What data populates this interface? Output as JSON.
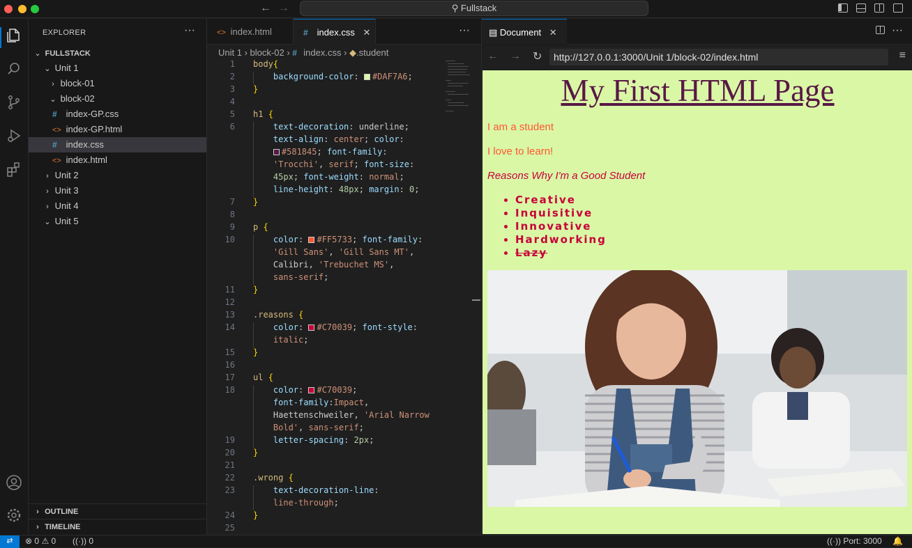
{
  "window": {
    "title": "Fullstack"
  },
  "activity": {
    "icons": [
      "files-icon",
      "search-icon",
      "source-control-icon",
      "run-debug-icon",
      "extensions-icon",
      "account-icon",
      "settings-icon"
    ]
  },
  "explorer": {
    "title": "EXPLORER",
    "root": "FULLSTACK",
    "items": [
      {
        "label": "Unit 1"
      },
      {
        "label": "block-01"
      },
      {
        "label": "block-02"
      },
      {
        "label": "index-GP.css"
      },
      {
        "label": "index-GP.html"
      },
      {
        "label": "index.css"
      },
      {
        "label": "index.html"
      },
      {
        "label": "Unit 2"
      },
      {
        "label": "Unit 3"
      },
      {
        "label": "Unit 4"
      },
      {
        "label": "Unit 5"
      }
    ],
    "outline": "OUTLINE",
    "timeline": "TIMELINE"
  },
  "editor": {
    "tabs": [
      {
        "label": "index.html"
      },
      {
        "label": "index.css"
      }
    ],
    "breadcrumb": {
      "unit": "Unit 1",
      "block": "block-02",
      "file": "index.css",
      "symbol": ".student"
    },
    "line_numbers": [
      "1",
      "2",
      "3",
      "4",
      "5",
      "6",
      "7",
      "8",
      "9",
      "10",
      "11",
      "12",
      "13",
      "14",
      "15",
      "16",
      "17",
      "18",
      "19",
      "20",
      "21",
      "22",
      "23",
      "24",
      "25"
    ]
  },
  "preview": {
    "tab_label": "Document",
    "url": "http://127.0.0.1:3000/Unit 1/block-02/index.html",
    "h1": "My First HTML Page",
    "p1": "I am a student",
    "p2": "I love to learn!",
    "reasons": "Reasons Why I'm a Good Student",
    "list": [
      "Creative",
      "Inquisitive",
      "Innovative",
      "Hardworking",
      "Lazy"
    ],
    "colors": {
      "background": "#DAF7A6",
      "h1": "#581845",
      "p": "#FF5733",
      "reasons": "#C70039"
    }
  },
  "status": {
    "errors": "0",
    "warnings": "0",
    "ports": "0",
    "port": "Port: 3000"
  }
}
